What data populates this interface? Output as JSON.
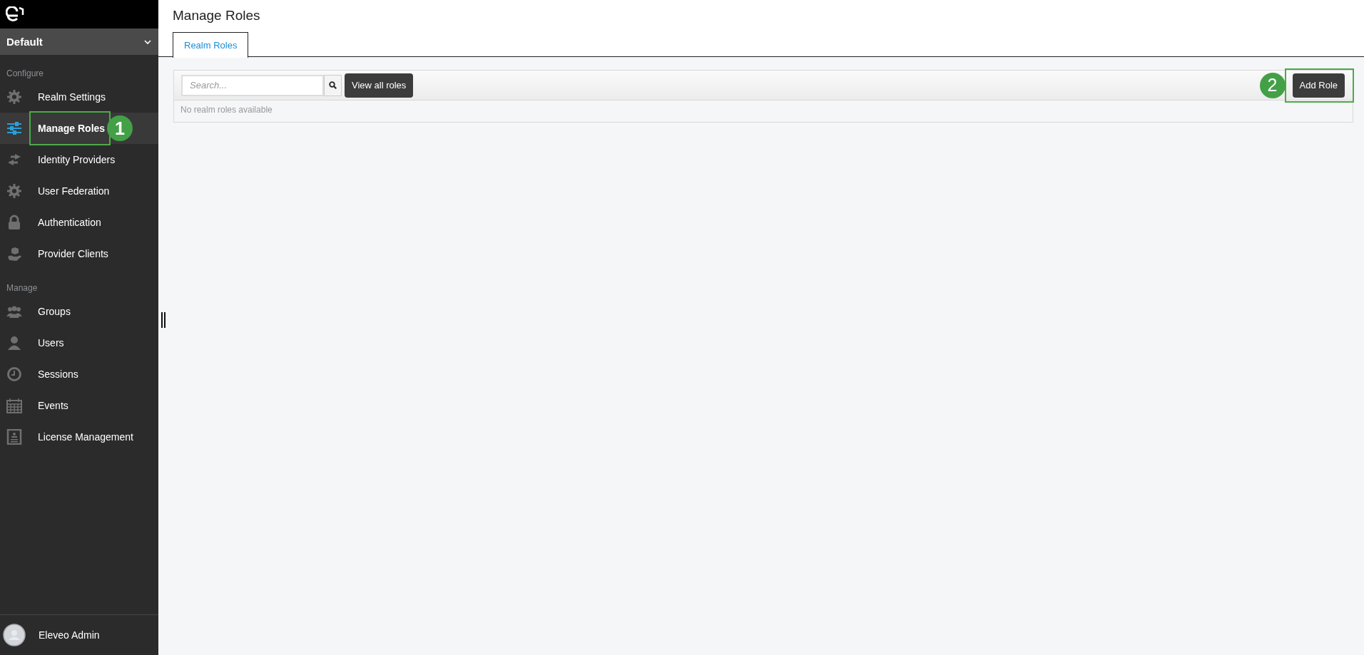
{
  "realm_selector": {
    "value": "Default"
  },
  "sidebar": {
    "sections": [
      {
        "title": "Configure",
        "items": [
          {
            "label": "Realm Settings",
            "selected": false
          },
          {
            "label": "Manage Roles",
            "selected": true
          },
          {
            "label": "Identity Providers",
            "selected": false
          },
          {
            "label": "User Federation",
            "selected": false
          },
          {
            "label": "Authentication",
            "selected": false
          },
          {
            "label": "Provider Clients",
            "selected": false
          }
        ]
      },
      {
        "title": "Manage",
        "items": [
          {
            "label": "Groups",
            "selected": false
          },
          {
            "label": "Users",
            "selected": false
          },
          {
            "label": "Sessions",
            "selected": false
          },
          {
            "label": "Events",
            "selected": false
          },
          {
            "label": "License Management",
            "selected": false
          }
        ]
      }
    ],
    "user": {
      "name": "Eleveo Admin"
    }
  },
  "page": {
    "title": "Manage Roles"
  },
  "tabs": [
    {
      "label": "Realm Roles",
      "selected": true
    }
  ],
  "toolbar": {
    "search": {
      "placeholder": "Search..."
    },
    "view_all_button": "View all roles",
    "add_button": "Add Role"
  },
  "table": {
    "empty_message": "No realm roles available"
  },
  "annotations": [
    {
      "label": "1"
    },
    {
      "label": "2"
    }
  ]
}
